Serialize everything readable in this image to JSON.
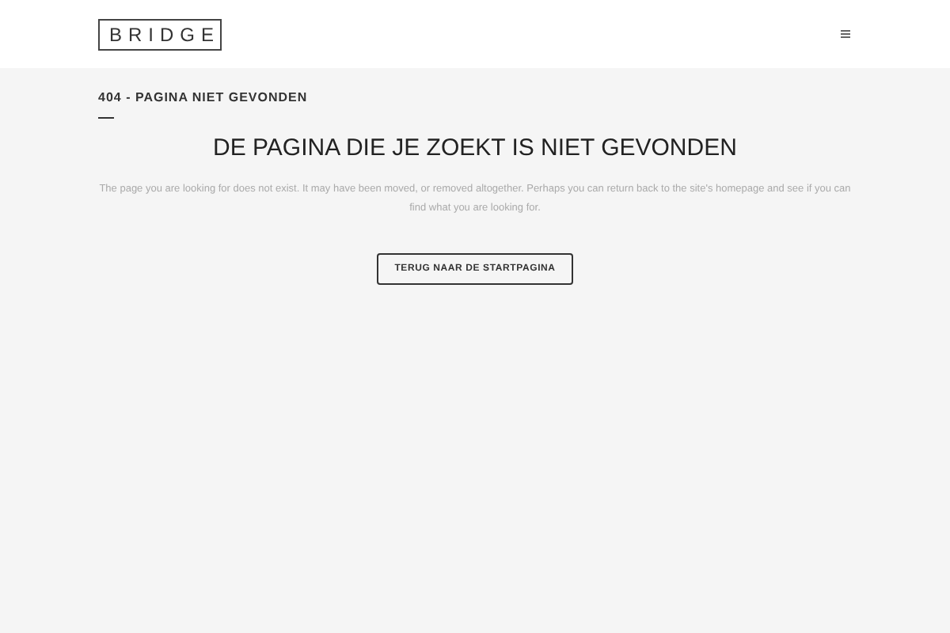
{
  "header": {
    "logo": "BRIDGE"
  },
  "title_bar": {
    "title": "404 - PAGINA NIET GEVONDEN"
  },
  "content": {
    "heading": "DE PAGINA DIE JE ZOEKT IS NIET GEVONDEN",
    "text": "The page you are looking for does not exist. It may have been moved, or removed altogether. Perhaps you can return back to the site's homepage and see if you can find what you are looking for.",
    "button": "TERUG NAAR DE STARTPAGINA"
  }
}
